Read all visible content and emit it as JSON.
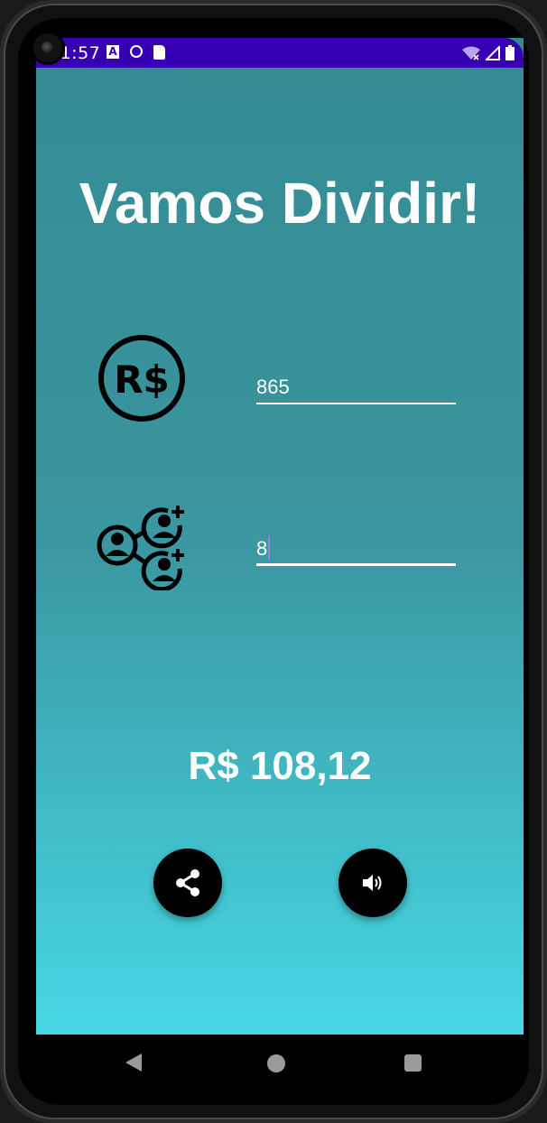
{
  "status_bar": {
    "time": "11:57",
    "color": "#3700b3"
  },
  "app": {
    "title": "Vamos Dividir!",
    "gradient_top": "#358a92",
    "gradient_bottom": "#46d8e4"
  },
  "amount_field": {
    "icon": "money-circle-icon",
    "value": "865"
  },
  "people_field": {
    "icon": "people-share-icon",
    "value": "8",
    "focused": true
  },
  "result": {
    "text": "R$ 108,12"
  },
  "actions": {
    "share_icon": "share-icon",
    "speak_icon": "speaker-icon"
  },
  "nav": {
    "back_icon": "back-triangle-icon",
    "home_icon": "home-circle-icon",
    "recents_icon": "recents-square-icon"
  }
}
